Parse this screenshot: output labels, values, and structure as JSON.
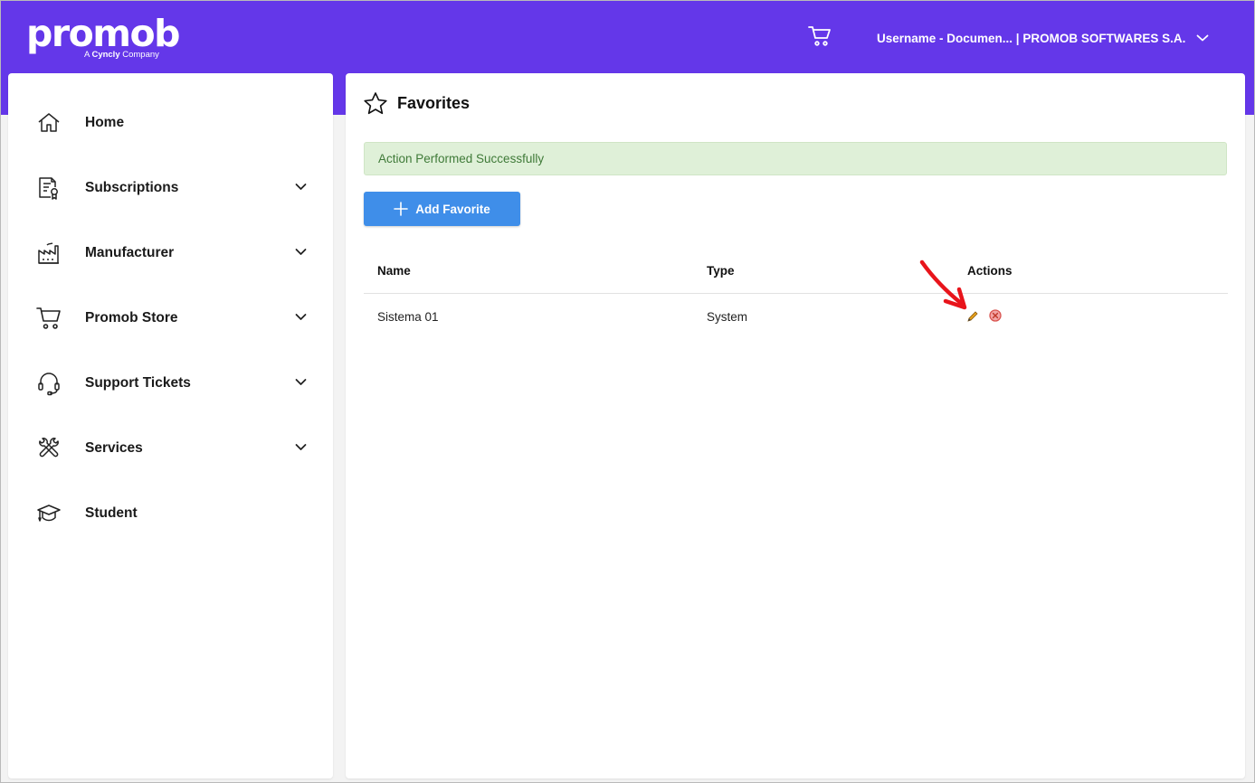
{
  "header": {
    "logo_word": "promob",
    "logo_tag_prefix": "A",
    "logo_tag_brand": "Cyncly",
    "logo_tag_suffix": "Company",
    "cart_icon": "cart-icon",
    "user_label": "Username - Documen... | PROMOB SOFTWARES S.A."
  },
  "sidebar": {
    "items": [
      {
        "label": "Home",
        "icon": "home-icon",
        "has_chevron": false
      },
      {
        "label": "Subscriptions",
        "icon": "certificate-document-icon",
        "has_chevron": true
      },
      {
        "label": "Manufacturer",
        "icon": "factory-icon",
        "has_chevron": true
      },
      {
        "label": "Promob Store",
        "icon": "cart-icon",
        "has_chevron": true
      },
      {
        "label": "Support Tickets",
        "icon": "headset-icon",
        "has_chevron": true
      },
      {
        "label": "Services",
        "icon": "tools-icon",
        "has_chevron": true
      },
      {
        "label": "Student",
        "icon": "graduation-cap-icon",
        "has_chevron": false
      }
    ]
  },
  "main": {
    "title": "Favorites",
    "title_icon": "star-outline-icon",
    "alert": "Action Performed Successfully",
    "add_button": "Add Favorite",
    "table": {
      "columns": [
        "Name",
        "Type",
        "Actions"
      ],
      "rows": [
        {
          "name": "Sistema 01",
          "type": "System",
          "actions": [
            "edit-icon",
            "delete-icon"
          ]
        }
      ]
    }
  },
  "colors": {
    "brand_purple": "#6437e9",
    "button_blue": "#3f8ee9",
    "alert_bg": "#dff0d8",
    "alert_text": "#3f7a38",
    "annotation_red": "#e8141b"
  }
}
